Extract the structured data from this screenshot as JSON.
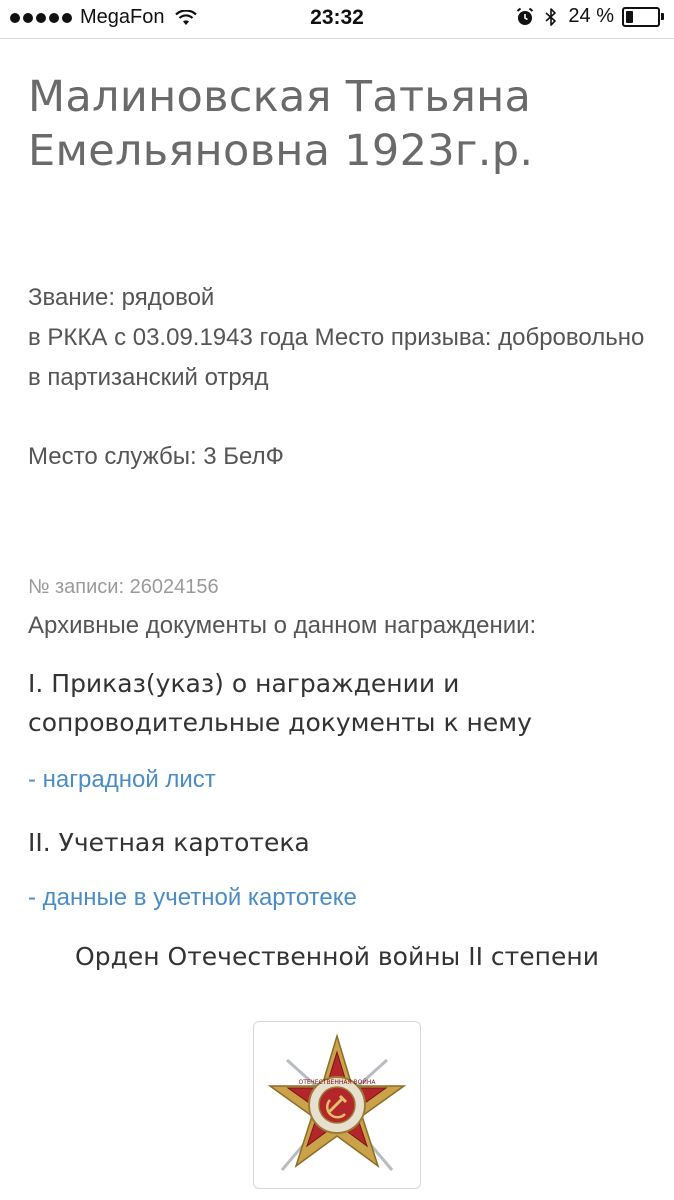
{
  "status": {
    "carrier": "MegaFon",
    "time": "23:32",
    "battery_text": "24 %",
    "battery_level": 0.24
  },
  "person": {
    "name": "Малиновская Татьяна Емельяновна 1923г.р."
  },
  "info": {
    "rank": "Звание: рядовой",
    "enlisted": "в РККА с 03.09.1943 года Место призыва: добровольно в партизанский отряд",
    "service": "Место службы: 3 БелФ"
  },
  "record": {
    "number": "№ записи: 26024156",
    "archive_heading": "Архивные документы о данном награждении:"
  },
  "sections": {
    "order_title": "I. Приказ(указ) о награждении и сопроводительные документы к нему",
    "award_sheet_link": "- наградной лист",
    "card_title": "II. Учетная картотека",
    "card_link": "- данные в учетной картотеке"
  },
  "award": {
    "name": "Орден Отечественной войны II степени",
    "icon": "order-patriotic-war-icon",
    "medal_text": "ОТЕЧЕСТВЕННАЯ ВОЙНА"
  },
  "colors": {
    "link": "#4a8cc7",
    "title": "#6a6a6a",
    "text": "#555555"
  }
}
